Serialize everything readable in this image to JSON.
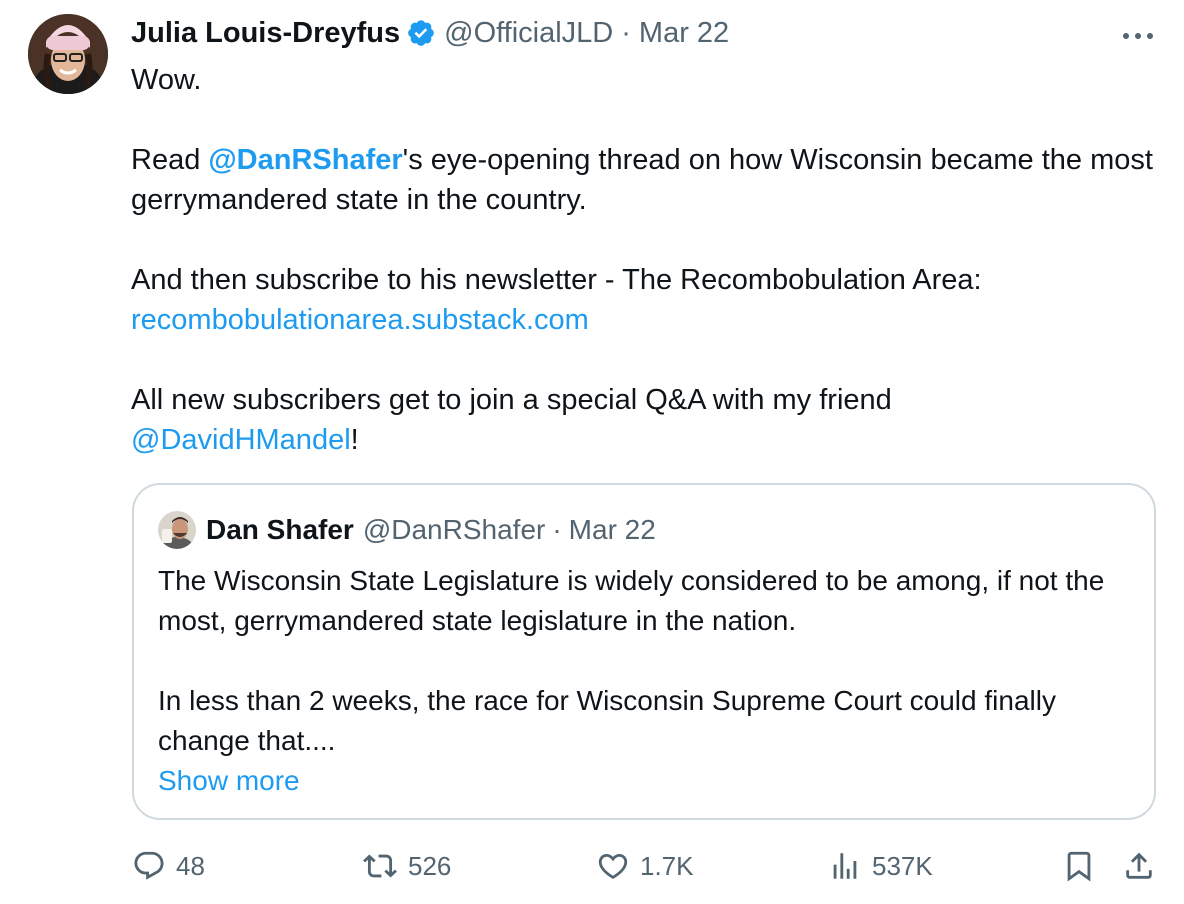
{
  "tweet": {
    "author_name": "Julia Louis-Dreyfus",
    "author_handle": "@OfficialJLD",
    "separator": "·",
    "date": "Mar 22",
    "text": {
      "line1": "Wow.",
      "p2_prefix": "Read ",
      "p2_mention": "@DanRShafer",
      "p2_suffix": "'s eye-opening thread on how Wisconsin became the most gerrymandered state in the country.",
      "p3": "And then subscribe to his newsletter - The Recombobulation Area:",
      "p3_link": "recombobulationarea.substack.com",
      "p4": "All new subscribers get to join a special Q&A with my friend ",
      "p4_mention": "@DavidHMandel",
      "p4_end": "!"
    }
  },
  "quoted_tweet": {
    "author_name": "Dan Shafer",
    "author_handle": "@DanRShafer",
    "separator": "·",
    "date": "Mar 22",
    "text_p1": "The Wisconsin State Legislature is widely considered to be among, if not the most, gerrymandered state legislature in the nation.",
    "text_p2": "In less than 2 weeks, the race for Wisconsin Supreme Court could finally change that....",
    "show_more": "Show more"
  },
  "actions": {
    "replies": "48",
    "reposts": "526",
    "likes": "1.7K",
    "views": "537K"
  },
  "icons": {
    "verified": "verified-badge-icon",
    "more": "more-options-icon",
    "reply": "reply-icon",
    "repost": "repost-icon",
    "like": "heart-icon",
    "views": "views-icon",
    "bookmark": "bookmark-icon",
    "share": "share-icon"
  },
  "colors": {
    "accent": "#1d9bf0",
    "text": "#0f1419",
    "secondary": "#536471",
    "border": "#cfd9de"
  }
}
